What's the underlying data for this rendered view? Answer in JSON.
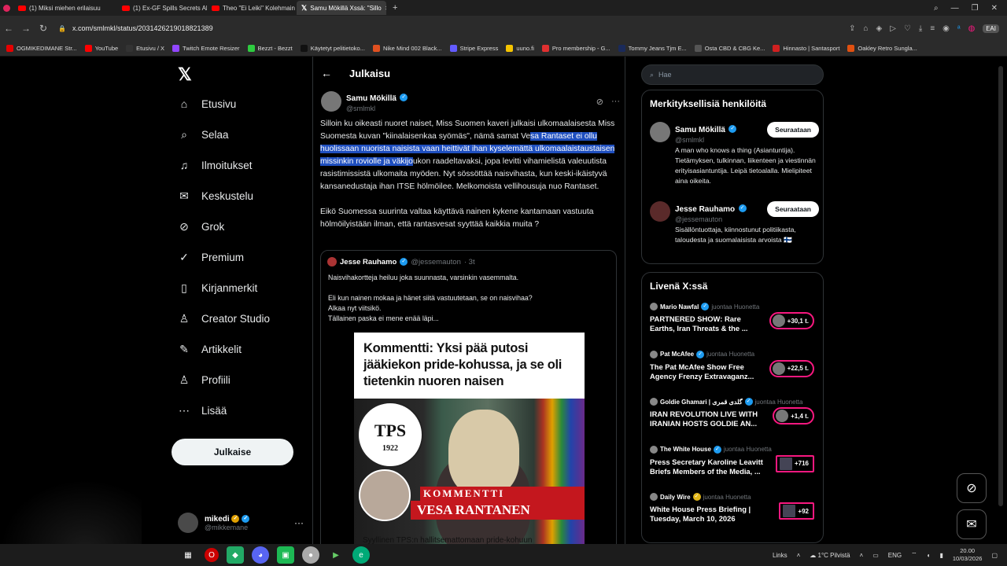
{
  "browser": {
    "tabs": [
      {
        "label": "(1) Miksi miehen erilaisuu",
        "active": false
      },
      {
        "label": "(1) Ex-GF Spills Secrets Ab",
        "active": false
      },
      {
        "label": "Theo \"Ei Leiki\" Kolehmain",
        "active": false
      },
      {
        "label": "Samu Mökillä Xssä: \"Sillo",
        "active": true
      }
    ],
    "new_tab": "+",
    "url": "x.com/smlmkl/status/2031426219018821389",
    "bookmarks": [
      {
        "label": "OGMIKEDIMANE Str...",
        "color": "#e60000"
      },
      {
        "label": "YouTube",
        "color": "#ff0000"
      },
      {
        "label": "Etusivu / X",
        "color": "#333"
      },
      {
        "label": "Twitch Emote Resizer",
        "color": "#9146ff"
      },
      {
        "label": "Bezzt - Bezzt",
        "color": "#2ecc40"
      },
      {
        "label": "Käytetyt pelitietoko...",
        "color": "#111"
      },
      {
        "label": "Nike Mind 002 Black...",
        "color": "#e05020"
      },
      {
        "label": "Stripe Express",
        "color": "#635bff"
      },
      {
        "label": "uuno.fi",
        "color": "#f5c400"
      },
      {
        "label": "Pro membership - G...",
        "color": "#e03030"
      },
      {
        "label": "Tommy Jeans Tjm E...",
        "color": "#1a2a5a"
      },
      {
        "label": "Osta CBD & CBG Ke...",
        "color": "#555"
      },
      {
        "label": "Hinnasto | Santasport",
        "color": "#d02020"
      },
      {
        "label": "Oakley Retro Sungla...",
        "color": "#e05010"
      }
    ]
  },
  "nav": {
    "items": [
      {
        "label": "Etusivu",
        "icon": "home-icon"
      },
      {
        "label": "Selaa",
        "icon": "search-icon"
      },
      {
        "label": "Ilmoitukset",
        "icon": "bell-icon"
      },
      {
        "label": "Keskustelu",
        "icon": "mail-icon"
      },
      {
        "label": "Grok",
        "icon": "grok-icon"
      },
      {
        "label": "Premium",
        "icon": "premium-icon"
      },
      {
        "label": "Kirjanmerkit",
        "icon": "bookmark-icon"
      },
      {
        "label": "Creator Studio",
        "icon": "creator-icon"
      },
      {
        "label": "Artikkelit",
        "icon": "article-icon"
      },
      {
        "label": "Profiili",
        "icon": "profile-icon"
      },
      {
        "label": "Lisää",
        "icon": "more-icon"
      }
    ],
    "post_button": "Julkaise",
    "account": {
      "name": "mikedi",
      "handle": "@mikkemane"
    }
  },
  "main": {
    "header": "Julkaisu",
    "tweet": {
      "author": "Samu Mökillä",
      "handle": "@smlmkl",
      "p1_a": "Silloin ku oikeasti nuoret naiset, Miss Suomen kaveri julkaisi ulkomaalaisesta Miss Suomesta kuvan \"kiinalaisenkaa syömäs\", nämä samat Ve",
      "p1_hl": "sa Rantaset ei ollu huolissaan nuorista naisista vaan heittivät ihan kyselemättä ulkomaalaistaustaisen missinkin roviolle ja väkijo",
      "p1_b": "ukon raadeltavaksi, jopa levitti vihamielistä valeuutista rasistimissistä ulkomaita myöden. Nyt sössöttää naisvihasta, kun keski-ikäistyvä kansanedustaja ihan ITSE hölmöilee. Melkomoista vellihousuja nuo Rantaset.",
      "p2": "Eikö Suomessa suurinta valtaa käyttävä nainen kykene kantamaan vastuuta hölmöilyistään ilman, että rantasvesat syyttää kaikkia muita ?"
    },
    "quote": {
      "author": "Jesse Rauhamo",
      "handle": "@jessemauton",
      "time": "· 3t",
      "line1": "Naisvihakortteja heiluu joka suunnasta, varsinkin vasemmalta.",
      "line2": "Eli kun nainen mokaa ja hänet siitä vastuutetaan, se on naisvihaa?",
      "line3": "Alkaa nyt viitsikö.",
      "line4": "Tällainen paska ei mene enää läpi...",
      "image": {
        "headline": "Kommentti: Yksi pää putosi jääkiekon pride-kohussa, ja se oli tietenkin nuoren naisen",
        "logo": "TPS",
        "logo_year": "1922",
        "banner": "KOMMENTTI",
        "name": "VESA RANTANEN",
        "caption": "Syyllinen TPS:n hallitsemattomaan pride-kohuun"
      }
    }
  },
  "right": {
    "search_placeholder": "Hae",
    "who_to_follow": {
      "title": "Merkityksellisiä henkilöitä",
      "people": [
        {
          "name": "Samu Mökillä",
          "handle": "@smlmkl",
          "bio": "A man who knows a thing (Asiantuntija). Tietämyksen, tulkinnan, liikenteen ja viestinnän erityisasiantuntija. Leipä tietoalalla. Mielipiteet aina oikeita.",
          "button": "Seuraataan"
        },
        {
          "name": "Jesse Rauhamo",
          "handle": "@jessemauton",
          "bio": "Sisällöntuottaja, kiinnostunut politiikasta, taloudesta ja suomalaisista arvoista 🇫🇮",
          "button": "Seuraataan"
        }
      ]
    },
    "live": {
      "title": "Livenä X:ssä",
      "items": [
        {
          "host": "Mario Nawfal",
          "role": "juontaa Huonetta",
          "title": "PARTNERED SHOW: Rare Earths, Iran Threats & the ...",
          "count": "+30,1 t.",
          "gold": false
        },
        {
          "host": "Pat McAfee",
          "role": "juontaa Huonetta",
          "title": "The Pat McAfee Show Free Agency Frenzy Extravaganz...",
          "count": "+22,5 t.",
          "gold": false
        },
        {
          "host": "Goldie Ghamari | گلدی قمری",
          "role": "juontaa Huonetta",
          "title": "IRAN REVOLUTION LIVE WITH IRANIAN HOSTS GOLDIE AN...",
          "count": "+1,4 t.",
          "gold": false
        },
        {
          "host": "The White House",
          "role": "juontaa Huonetta",
          "title": "Press Secretary Karoline Leavitt Briefs Members of the Media, ...",
          "count": "+716",
          "gold": false
        },
        {
          "host": "Daily Wire",
          "role": "juontaa Huonetta",
          "title": "White House Press Briefing | Tuesday, March 10, 2026",
          "count": "+92",
          "gold": true
        }
      ]
    }
  },
  "taskbar": {
    "links": "Links",
    "weather": "1°C Pilvistä",
    "lang": "ENG",
    "time": "20.00",
    "date": "10/03/2026"
  },
  "colors": {
    "accent": "#1d9bf0",
    "live": "#f91880",
    "highlight": "#1f4fbf"
  }
}
